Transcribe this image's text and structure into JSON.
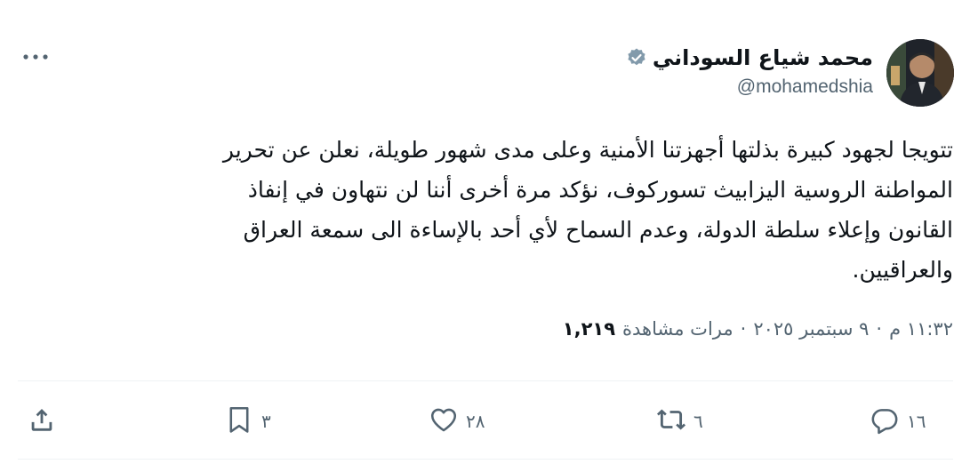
{
  "author": {
    "name": "محمد شياع السوداني",
    "handle": "@mohamedshia",
    "verified_icon": "verified-badge-icon",
    "avatar": "avatar-photo"
  },
  "tweet": {
    "text": "تتويجا لجهود كبيرة بذلتها أجهزتنا الأمنية وعلى مدى شهور طويلة، نعلن عن تحرير\nالمواطنة الروسية اليزابيث تسوركوف، نؤكد مرة أخرى أننا لن نتهاون في إنفاذ\nالقانون وإعلاء سلطة الدولة، وعدم السماح لأي أحد بالإساءة الى سمعة العراق\nوالعراقيين."
  },
  "meta": {
    "time": "١١:٣٢ م",
    "separator": "·",
    "date": "٩ سبتمبر ٢٠٢٥",
    "views_count": "١,٢١٩",
    "views_label": "مرات مشاهدة"
  },
  "actions": {
    "reply": {
      "icon": "reply-icon",
      "count": "١٦"
    },
    "repost": {
      "icon": "repost-icon",
      "count": "٦"
    },
    "like": {
      "icon": "heart-icon",
      "count": "٢٨"
    },
    "bookmark": {
      "icon": "bookmark-icon",
      "count": "٣"
    },
    "share": {
      "icon": "share-icon"
    }
  },
  "colors": {
    "text": "#0f1419",
    "secondary": "#536471",
    "divider": "#eff3f4",
    "verified": "#829aab"
  }
}
